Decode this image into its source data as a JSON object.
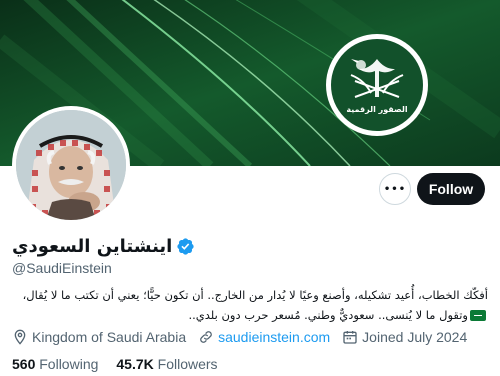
{
  "profile": {
    "display_name": "اينشتاين السعودي",
    "handle": "@SaudiEinstein",
    "bio_lines": [
      "أفكّك الخطاب، أُعيد تشكيله، وأصنع وعيًا لا يُدار من الخارج.. أن تكون حيًّا؛ يعني أن تكتب ما لا يُقال،",
      "وتقول ما لا يُنسى.. سعوديٌّ وطني. مُسعر حرب دون بلدي.."
    ],
    "location": "Kingdom of Saudi Arabia",
    "website": "saudieinstein.com",
    "joined": "Joined July 2024",
    "following_count": "560",
    "following_label": "Following",
    "followers_count": "45.7K",
    "followers_label": "Followers"
  },
  "banner": {
    "emblem_caption": "الصقور الرقمية",
    "colors": {
      "dark": "#0d3a1e",
      "mid": "#1f6b36",
      "light": "#5fd07a"
    }
  },
  "actions": {
    "more_label": "•••",
    "follow_label": "Follow"
  },
  "icons": {
    "verified": "verified-badge-icon",
    "location": "location-pin-icon",
    "link": "link-icon",
    "calendar": "calendar-icon",
    "more": "more-dots-icon",
    "flag": "saudi-flag-emoji-icon"
  },
  "colors": {
    "accent_blue": "#1d9bf0",
    "secondary_text": "#536471",
    "primary_text": "#0f1419",
    "follow_bg": "#0f1419"
  }
}
